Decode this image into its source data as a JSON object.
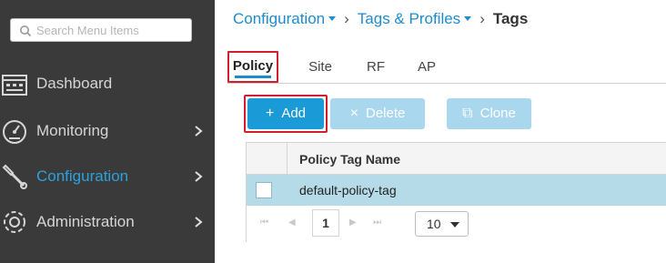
{
  "sidebar": {
    "search_placeholder": "Search Menu Items",
    "items": [
      {
        "label": "Dashboard",
        "icon": "dashboard-icon",
        "has_submenu": false
      },
      {
        "label": "Monitoring",
        "icon": "monitoring-gauge-icon",
        "has_submenu": true
      },
      {
        "label": "Configuration",
        "icon": "configuration-wrench-icon",
        "has_submenu": true,
        "active": true
      },
      {
        "label": "Administration",
        "icon": "administration-gear-icon",
        "has_submenu": true
      }
    ]
  },
  "breadcrumb": {
    "item1": "Configuration",
    "item2": "Tags & Profiles",
    "current": "Tags"
  },
  "tabs": [
    {
      "label": "Policy",
      "active": true
    },
    {
      "label": "Site"
    },
    {
      "label": "RF"
    },
    {
      "label": "AP"
    }
  ],
  "toolbar": {
    "add_label": "Add",
    "delete_label": "Delete",
    "clone_label": "Clone"
  },
  "grid": {
    "columns": [
      "Policy Tag Name"
    ],
    "rows": [
      {
        "policy_tag_name": "default-policy-tag"
      }
    ],
    "pager": {
      "current_page": "1",
      "page_size": "10"
    }
  },
  "colors": {
    "sidebar_bg": "#3a3a3a",
    "accent": "#1d8ccf",
    "active_nav": "#2aa3dd",
    "highlight_box": "#d0202e",
    "selected_row": "#b6dbe8"
  }
}
